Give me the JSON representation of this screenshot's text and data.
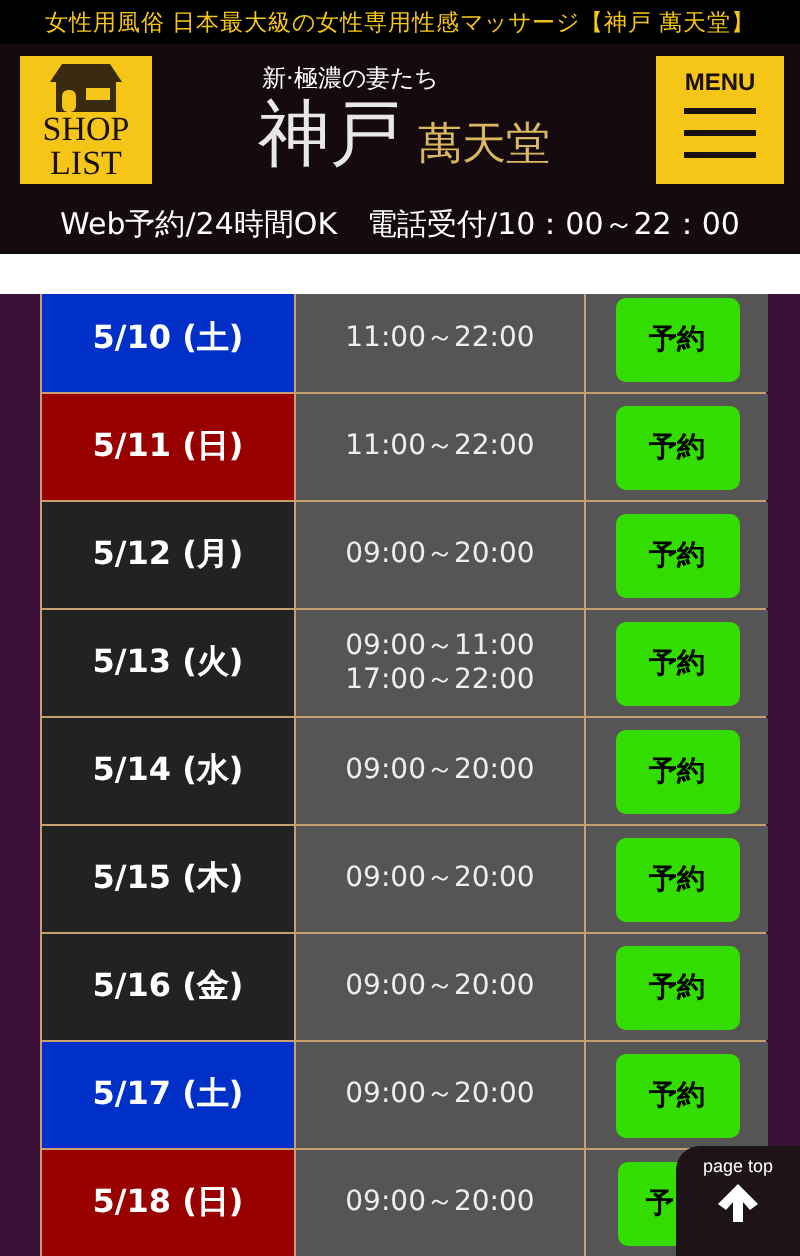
{
  "top_bar": {
    "text": "女性用風俗 日本最大級の女性専用性感マッサージ【神戸 萬天堂】"
  },
  "header": {
    "shop_list": [
      "SHOP",
      "LIST"
    ],
    "logo": {
      "tagline": "新·極濃の妻たち",
      "city": "神戸",
      "name": "萬天堂"
    },
    "menu": "MENU"
  },
  "info_line": "Web予約/24時間OK　電話受付/10：00～22：00",
  "schedule": [
    {
      "date": "5/10 (土)",
      "color": "#0030c8",
      "hours": [
        "11:00～22:00"
      ],
      "button": "予約"
    },
    {
      "date": "5/11 (日)",
      "color": "#990000",
      "hours": [
        "11:00～22:00"
      ],
      "button": "予約"
    },
    {
      "date": "5/12 (月)",
      "color": "#222222",
      "hours": [
        "09:00～20:00"
      ],
      "button": "予約"
    },
    {
      "date": "5/13 (火)",
      "color": "#222222",
      "hours": [
        "09:00～11:00",
        "17:00～22:00"
      ],
      "button": "予約"
    },
    {
      "date": "5/14 (水)",
      "color": "#222222",
      "hours": [
        "09:00～20:00"
      ],
      "button": "予約"
    },
    {
      "date": "5/15 (木)",
      "color": "#222222",
      "hours": [
        "09:00～20:00"
      ],
      "button": "予約"
    },
    {
      "date": "5/16 (金)",
      "color": "#222222",
      "hours": [
        "09:00～20:00"
      ],
      "button": "予約"
    },
    {
      "date": "5/17 (土)",
      "color": "#0030c8",
      "hours": [
        "09:00～20:00"
      ],
      "button": "予約"
    },
    {
      "date": "5/18 (日)",
      "color": "#990000",
      "hours": [
        "09:00～20:00"
      ],
      "button": "予"
    }
  ],
  "page_top": "page top"
}
